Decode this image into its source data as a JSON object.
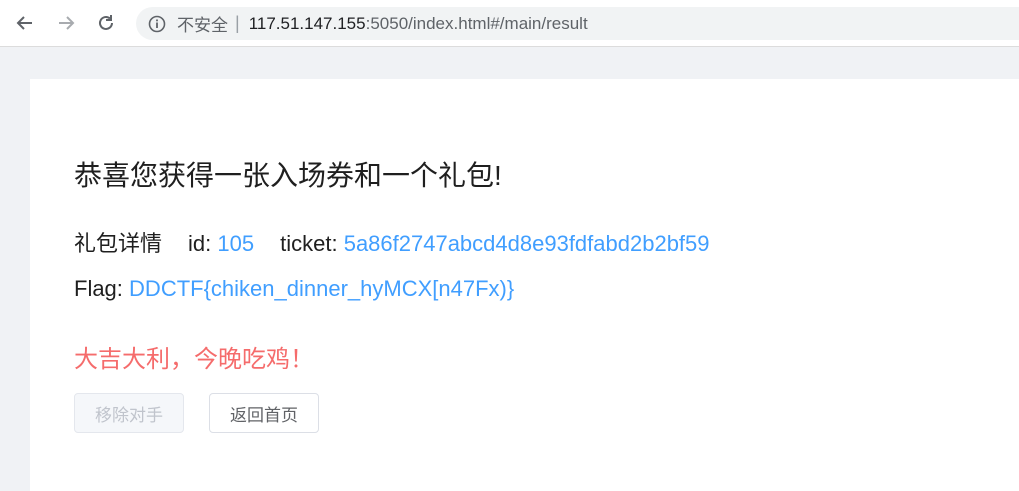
{
  "browser": {
    "security_label": "不安全",
    "separator": "|",
    "url_host": "117.51.147.155",
    "url_path": ":5050/index.html#/main/result",
    "icons": [
      "back-arrow-icon",
      "forward-arrow-icon",
      "reload-icon",
      "info-icon"
    ]
  },
  "result": {
    "title": "恭喜您获得一张入场券和一个礼包!",
    "detail_label": "礼包详情",
    "id_label": "id:",
    "id_value": "105",
    "ticket_label": "ticket:",
    "ticket_value": "5a86f2747abcd4d8e93fdfabd2b2bf59",
    "flag_label": "Flag:",
    "flag_value": "DDCTF{chiken_dinner_hyMCX[n47Fx)}",
    "congrats": "大吉大利，今晚吃鸡！"
  },
  "buttons": {
    "remove_label": "移除对手",
    "home_label": "返回首页"
  },
  "colors": {
    "accent": "#409eff",
    "danger": "#f56c6c"
  }
}
